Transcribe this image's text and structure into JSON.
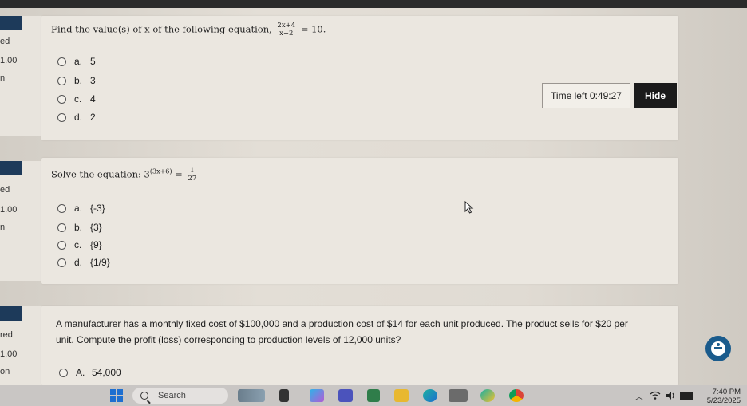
{
  "question1": {
    "sidebar": {
      "flag_text": "ed",
      "mark": "1.00",
      "extra": "n"
    },
    "prompt": "Find the value(s) of x of the following equation,",
    "fraction_num": "2x+4",
    "fraction_den": "x−2",
    "equation_tail": "= 10.",
    "options": [
      {
        "letter": "a.",
        "text": "5"
      },
      {
        "letter": "b.",
        "text": "3"
      },
      {
        "letter": "c.",
        "text": "4"
      },
      {
        "letter": "d.",
        "text": "2"
      }
    ]
  },
  "timer": {
    "label": "Time left 0:49:27",
    "hide_label": "Hide"
  },
  "question2": {
    "sidebar": {
      "flag_text": "ed",
      "mark": "1.00",
      "extra": "n"
    },
    "prompt": "Solve the equation:",
    "base": "3",
    "exponent": "(3x+6)",
    "equals": "=",
    "fraction_num": "1",
    "fraction_den": "27",
    "options": [
      {
        "letter": "a.",
        "text": "{-3}"
      },
      {
        "letter": "b.",
        "text": "{3}"
      },
      {
        "letter": "c.",
        "text": "{9}"
      },
      {
        "letter": "d.",
        "text": "{1/9}"
      }
    ]
  },
  "question3": {
    "sidebar": {
      "flag_text": "red",
      "mark": "1.00",
      "extra": "on"
    },
    "prompt_line1": "A manufacturer has a monthly fixed cost of $100,000 and a production cost of $14   for each unit produced. The product sells for $20 per",
    "prompt_line2": "unit. Compute the profit (loss) corresponding to production levels of 12,000 units?",
    "options": [
      {
        "letter": "A.",
        "text": "54,000"
      }
    ]
  },
  "taskbar": {
    "search_label": "Search",
    "time": "7:40 PM",
    "date": "5/23/2025"
  },
  "colors": {
    "accent_dark": "#1d3a5a",
    "hide_button": "#1b1b1b",
    "accessibility": "#1a5b8c",
    "windows_blue": "#1e6fd0"
  }
}
